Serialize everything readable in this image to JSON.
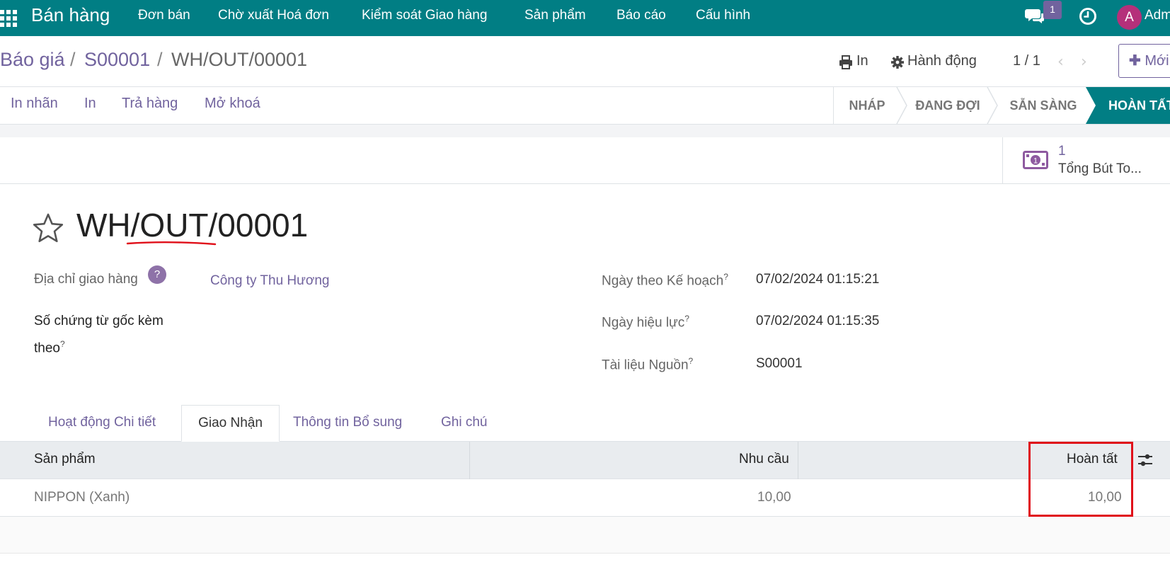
{
  "navbar": {
    "app_title": "Bán hàng",
    "menu": [
      "Đơn bán",
      "Chờ xuất Hoá đơn",
      "Kiểm soát Giao hàng",
      "Sản phẩm",
      "Báo cáo",
      "Cấu hình"
    ],
    "chat_count": "1",
    "avatar_letter": "A",
    "user_name": "Adm"
  },
  "breadcrumb": {
    "items": [
      "Báo giá",
      "S00001"
    ],
    "separator": "/",
    "current": "WH/OUT/00001"
  },
  "control_panel": {
    "print_label": "In",
    "action_label": "Hành động",
    "pager": "1 / 1",
    "new_label": "Mới"
  },
  "action_buttons": [
    "In nhãn",
    "In",
    "Trả hàng",
    "Mở khoá"
  ],
  "stages": {
    "items": [
      "NHÁP",
      "ĐANG ĐỢI",
      "SẴN SÀNG"
    ],
    "active": "HOÀN TẤT"
  },
  "smart_button": {
    "count": "1",
    "label": "Tổng Bút To..."
  },
  "record": {
    "title": "WH/OUT/00001"
  },
  "fields": {
    "delivery_address_label": "Địa chỉ giao hàng",
    "delivery_address_help": "?",
    "delivery_address_value": "Công ty Thu Hương",
    "origin_label_line1": "Số chứng từ gốc kèm",
    "origin_label_line2": "theo",
    "scheduled_label": "Ngày theo Kế hoạch",
    "scheduled_value": "07/02/2024 01:15:21",
    "effective_label": "Ngày hiệu lực",
    "effective_value": "07/02/2024 01:15:35",
    "source_label": "Tài liệu Nguồn",
    "source_value": "S00001",
    "tooltip_mark": "?"
  },
  "tabs": {
    "items": [
      "Hoạt động Chi tiết",
      "Giao Nhận",
      "Thông tin Bổ sung",
      "Ghi chú"
    ],
    "active_index": 1
  },
  "table": {
    "columns": [
      "Sản phẩm",
      "Nhu cầu",
      "Hoàn tất"
    ],
    "rows": [
      {
        "product": "NIPPON (Xanh)",
        "demand": "10,00",
        "done": "10,00"
      }
    ]
  },
  "colors": {
    "brand_teal": "#017e84",
    "link_purple": "#71639e",
    "highlight_red": "#e0101a"
  }
}
